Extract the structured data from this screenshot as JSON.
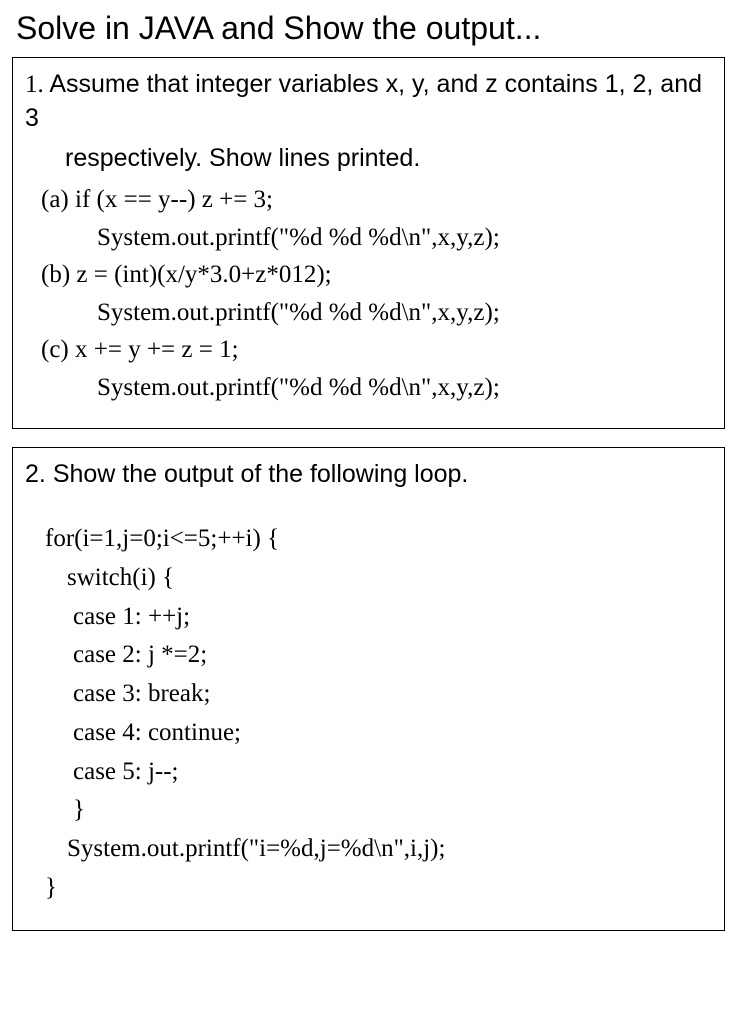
{
  "title": "Solve in JAVA and Show the output...",
  "q1": {
    "number": "1.",
    "prompt_line1": "Assume that integer variables x, y, and z contains 1, 2, and 3",
    "prompt_line2": "respectively. Show lines printed.",
    "a_label": "(a) if (x == y--) z += 3;",
    "a_print": "System.out.printf(\"%d %d %d\\n\",x,y,z);",
    "b_label": "(b) z = (int)(x/y*3.0+z*012);",
    "b_print": "System.out.printf(\"%d %d %d\\n\",x,y,z);",
    "c_label": "(c) x += y += z = 1;",
    "c_print": "System.out.printf(\"%d %d %d\\n\",x,y,z);"
  },
  "q2": {
    "number": "2.",
    "prompt": "Show the output of the following loop.",
    "lines": [
      "for(i=1,j=0;i<=5;++i) {",
      "switch(i) {",
      "case 1: ++j;",
      "case 2: j *=2;",
      "case 3: break;",
      "case 4: continue;",
      "case 5: j--;",
      "}",
      "System.out.printf(\"i=%d,j=%d\\n\",i,j);",
      "}"
    ]
  }
}
